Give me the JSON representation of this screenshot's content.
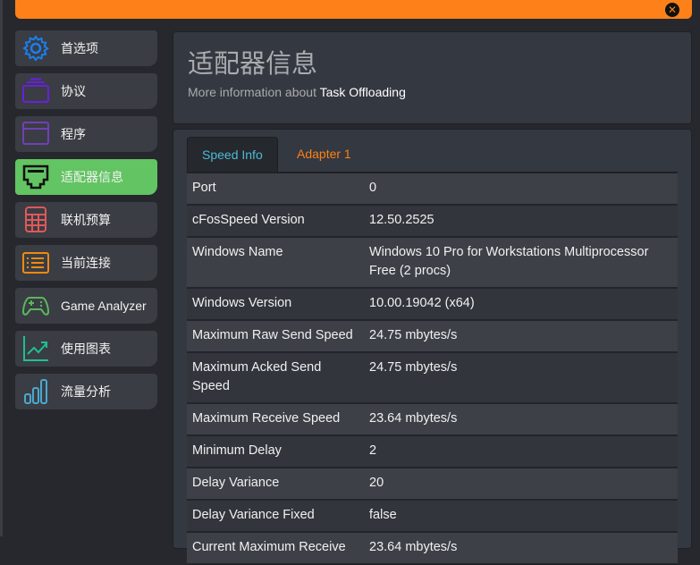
{
  "sidebar": {
    "items": [
      {
        "label": "首选项",
        "icon": "gear-icon",
        "color": "#1a7ff0"
      },
      {
        "label": "协议",
        "icon": "layers-icon",
        "color": "#6a1ee0"
      },
      {
        "label": "程序",
        "icon": "window-icon",
        "color": "#7040b8"
      },
      {
        "label": "适配器信息",
        "icon": "ethernet-port-icon",
        "color": "#111111",
        "active": true
      },
      {
        "label": "联机预算",
        "icon": "calculator-icon",
        "color": "#e05858"
      },
      {
        "label": "当前连接",
        "icon": "list-icon",
        "color": "#f08a10"
      },
      {
        "label": "Game Analyzer",
        "icon": "gamepad-icon",
        "color": "#5ab85a"
      },
      {
        "label": "使用图表",
        "icon": "line-chart-icon",
        "color": "#20c090"
      },
      {
        "label": "流量分析",
        "icon": "bar-chart-icon",
        "color": "#4aa8d0"
      }
    ]
  },
  "header": {
    "title": "适配器信息",
    "subtitle_prefix": "More information about",
    "subtitle_highlight": "Task Offloading"
  },
  "tabs": [
    {
      "label": "Speed Info"
    },
    {
      "label": "Adapter 1"
    }
  ],
  "table": {
    "rows": [
      {
        "key": "Port",
        "value": "0"
      },
      {
        "key": "cFosSpeed Version",
        "value": "12.50.2525"
      },
      {
        "key": "Windows Name",
        "value": "Windows 10 Pro for Workstations Multiprocessor Free (2 procs)"
      },
      {
        "key": "Windows Version",
        "value": "10.00.19042 (x64)"
      },
      {
        "key": "Maximum Raw Send Speed",
        "value": "24.75 mbytes/s"
      },
      {
        "key": "Maximum Acked Send Speed",
        "value": "24.75 mbytes/s"
      },
      {
        "key": "Maximum Receive Speed",
        "value": "23.64 mbytes/s"
      },
      {
        "key": "Minimum Delay",
        "value": "2"
      },
      {
        "key": "Delay Variance",
        "value": "20"
      },
      {
        "key": "Delay Variance Fixed",
        "value": "false"
      },
      {
        "key": "Current Maximum Receive",
        "value": "23.64 mbytes/s"
      }
    ]
  },
  "colors": {
    "accent": "#fd8118",
    "active": "#62c462",
    "tab_active": "#4dbbd8"
  }
}
